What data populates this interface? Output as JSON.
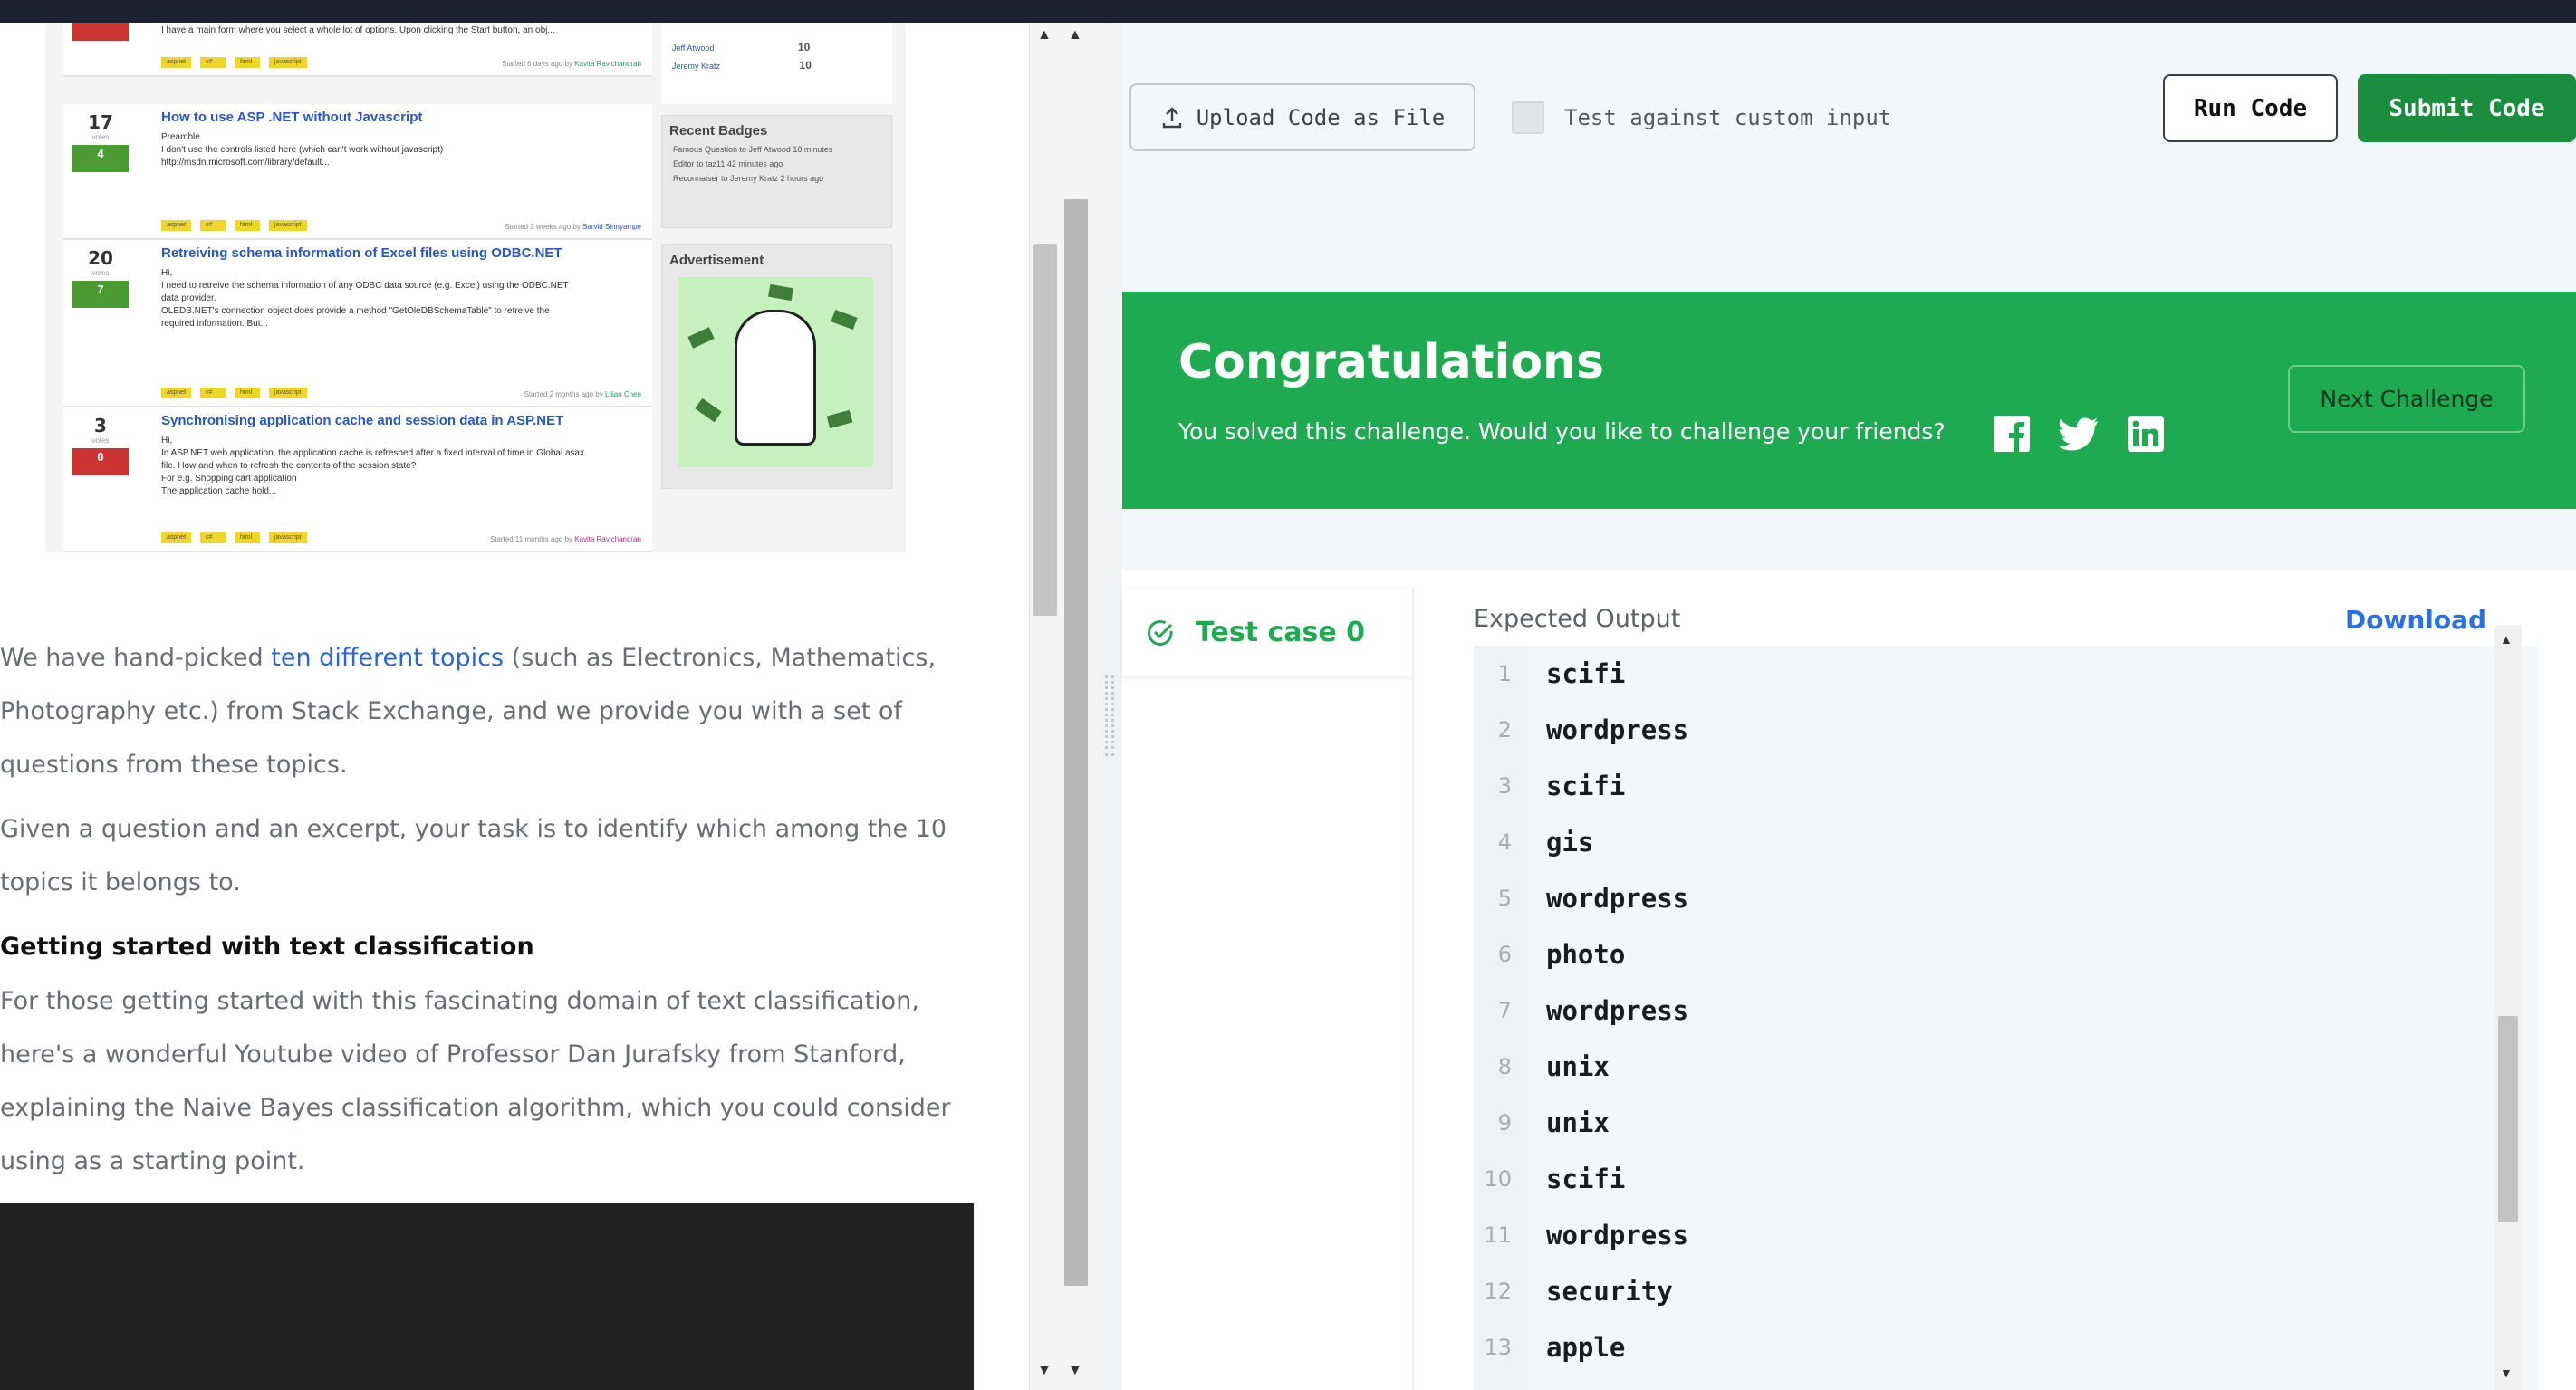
{
  "left_panel": {
    "questions": [
      {
        "votes": "",
        "answers": "",
        "title": "",
        "body": "I have a main form where you select a whole lot of options. Upon clicking the Start button, an obj...",
        "tags": [
          "aspnet",
          "c#",
          "html",
          "javascript"
        ],
        "meta": "Started 6 days ago by",
        "author": "Kavita Ravichandran"
      },
      {
        "votes": "17",
        "answers": "4",
        "title": "How to use ASP .NET without Javascript",
        "body": "Preamble\nI don't use the controls listed here (which can't work without javascript)\nhttp://msdn.microsoft.com/library/default...",
        "tags": [
          "aspnet",
          "c#",
          "html",
          "javascript"
        ],
        "meta": "Started 2 weeks ago by",
        "author": "Sarvid Sinnyampe"
      },
      {
        "votes": "20",
        "answers": "7",
        "title": "Retreiving schema information of Excel files using ODBC.NET",
        "body": "Hi,\nI need to retreive the schema information of any ODBC data source (e.g. Excel) using the ODBC.NET\ndata provider.\nOLEDB.NET's connection object does provide a method \"GetOleDBSchemaTable\" to retreive the\nrequired information. But...",
        "tags": [
          "aspnet",
          "c#",
          "html",
          "javascript"
        ],
        "meta": "Started 2 months ago by",
        "author": "Lilian Chen"
      },
      {
        "votes": "3",
        "answers": "0",
        "title": "Synchronising application cache and session data in ASP.NET",
        "body": "Hi,\nIn ASP.NET web application, the application cache is refreshed after a fixed interval of time in Global.asax\nfile. How and when to refresh the contents of the session state?\nFor e.g. Shopping cart application\nThe application cache hold...",
        "tags": [
          "aspnet",
          "c#",
          "html",
          "javascript"
        ],
        "meta": "Started 11 months ago by",
        "author": "Kavita Ravichandran"
      }
    ],
    "side_users": [
      {
        "name": "Jeff Atwood",
        "score": "10"
      },
      {
        "name": "Jeremy Kratz",
        "score": "10"
      }
    ],
    "recent_badges_title": "Recent Badges",
    "recent_badges": [
      "Famous Question to Jeff Atwood 18 minutes",
      "Editor to taz11 42 minutes ago",
      "Reconnaiser to Jeremy Kratz 2 hours ago"
    ],
    "advertisement_title": "Advertisement",
    "description": {
      "p1_before": "We have hand-picked ",
      "p1_link": "ten different topics",
      "p1_after": " (such as Electronics, Mathematics, Photography etc.) from Stack Exchange, and we provide you with a set of questions from these topics.",
      "p2": "Given a question and an excerpt, your task is to identify which among the 10 topics it belongs to.",
      "heading": "Getting started with text classification",
      "p3": "For those getting started with this fascinating domain of text classification, here's a wonderful Youtube video of Professor Dan Jurafsky from Stanford, explaining the Naive Bayes classification algorithm, which you could consider using as a starting point."
    }
  },
  "editor_toolbar": {
    "upload_label": "Upload Code as File",
    "custom_input_label": "Test against custom input",
    "run_label": "Run Code",
    "submit_label": "Submit Code"
  },
  "congrats": {
    "title": "Congratulations",
    "message": "You solved this challenge. Would you like to challenge your friends?",
    "next_label": "Next Challenge",
    "social_icons": [
      "facebook-icon",
      "twitter-icon",
      "linkedin-icon"
    ]
  },
  "results": {
    "test_case_label": "Test case 0",
    "output_title": "Expected Output",
    "download_label": "Download",
    "lines": [
      {
        "n": "1",
        "text": "scifi"
      },
      {
        "n": "2",
        "text": "wordpress"
      },
      {
        "n": "3",
        "text": "scifi"
      },
      {
        "n": "4",
        "text": "gis"
      },
      {
        "n": "5",
        "text": "wordpress"
      },
      {
        "n": "6",
        "text": "photo"
      },
      {
        "n": "7",
        "text": "wordpress"
      },
      {
        "n": "8",
        "text": "unix"
      },
      {
        "n": "9",
        "text": "unix"
      },
      {
        "n": "10",
        "text": "scifi"
      },
      {
        "n": "11",
        "text": "wordpress"
      },
      {
        "n": "12",
        "text": "security"
      },
      {
        "n": "13",
        "text": "apple"
      }
    ]
  },
  "colors": {
    "accent_green": "#1eaa50",
    "submit_green": "#1a8d3f",
    "link_blue": "#2a70e0"
  }
}
